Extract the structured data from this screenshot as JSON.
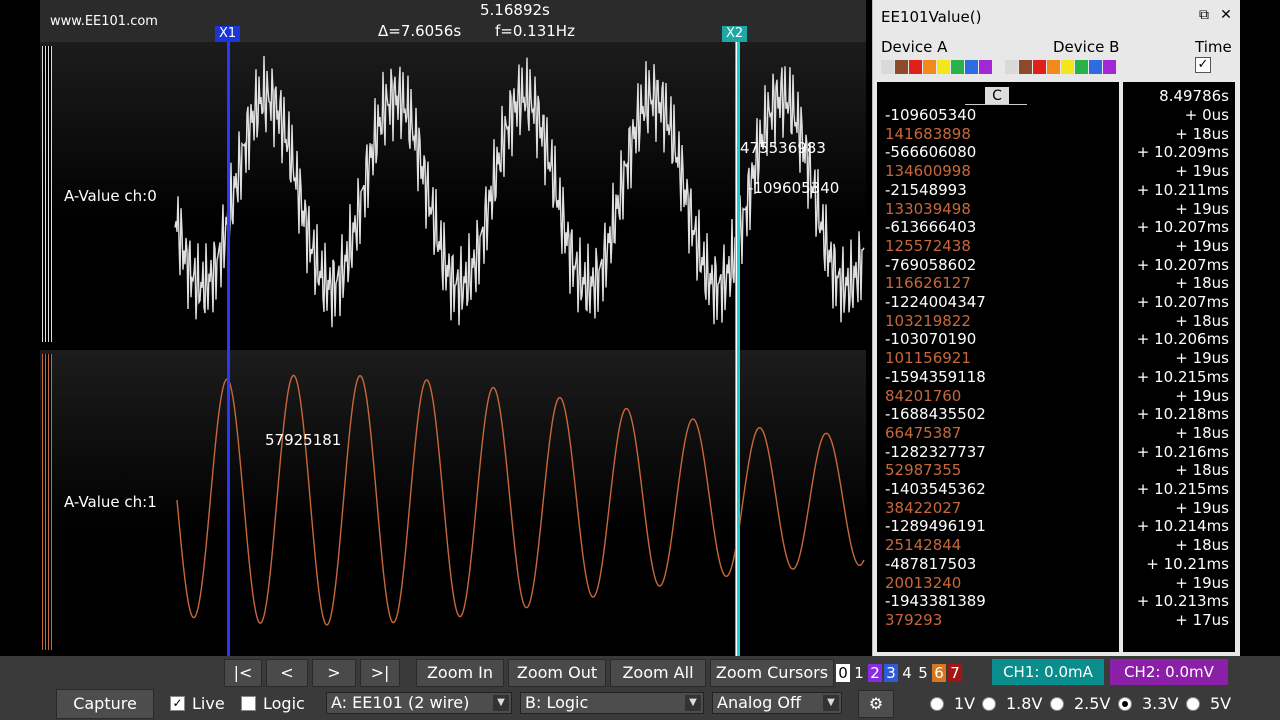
{
  "header": {
    "site": "www.EE101.com",
    "cursor_time": "5.16892s",
    "delta": "Δ=7.6056s",
    "freq": "f=0.131Hz",
    "x1": "X1",
    "x2": "X2"
  },
  "lanes": [
    {
      "label": "A-Value ch:0",
      "color": "#e0e0e0"
    },
    {
      "label": "A-Value ch:1",
      "color": "#c8683a"
    }
  ],
  "cursor_values": {
    "x2_ch0_a": "475536983",
    "x2_ch0_b": "-109605340",
    "x1_ch1": "57925181"
  },
  "panel": {
    "title": "EE101Value()",
    "restore_icon": "restore-icon",
    "close_icon": "close-icon",
    "device_a": "Device A",
    "device_b": "Device B",
    "time_label": "Time",
    "time_checked": true,
    "swatches_a": [
      "#d9d9d9",
      "#8b4a2b",
      "#e0201a",
      "#f18a1a",
      "#f3e61b",
      "#27b34a",
      "#2e6cdf",
      "#a228d6"
    ],
    "swatches_b": [
      "#d9d9d9",
      "#8b4a2b",
      "#e0201a",
      "#f18a1a",
      "#f3e61b",
      "#27b34a",
      "#2e6cdf",
      "#a228d6"
    ],
    "column_header": "C",
    "first_time": "8.49786s",
    "rows": [
      {
        "value": "-109605340",
        "time": "+ 0us",
        "kind": "a"
      },
      {
        "value": "141683898",
        "time": "+ 18us",
        "kind": "b"
      },
      {
        "value": "-566606080",
        "time": "+ 10.209ms",
        "kind": "a"
      },
      {
        "value": "134600998",
        "time": "+ 19us",
        "kind": "b"
      },
      {
        "value": "-21548993",
        "time": "+ 10.211ms",
        "kind": "a"
      },
      {
        "value": "133039498",
        "time": "+ 19us",
        "kind": "b"
      },
      {
        "value": "-613666403",
        "time": "+ 10.207ms",
        "kind": "a"
      },
      {
        "value": "125572438",
        "time": "+ 19us",
        "kind": "b"
      },
      {
        "value": "-769058602",
        "time": "+ 10.207ms",
        "kind": "a"
      },
      {
        "value": "116626127",
        "time": "+ 18us",
        "kind": "b"
      },
      {
        "value": "-1224004347",
        "time": "+ 10.207ms",
        "kind": "a"
      },
      {
        "value": "103219822",
        "time": "+ 18us",
        "kind": "b"
      },
      {
        "value": "-103070190",
        "time": "+ 10.206ms",
        "kind": "a"
      },
      {
        "value": "101156921",
        "time": "+ 19us",
        "kind": "b"
      },
      {
        "value": "-1594359118",
        "time": "+ 10.215ms",
        "kind": "a"
      },
      {
        "value": "84201760",
        "time": "+ 19us",
        "kind": "b"
      },
      {
        "value": "-1688435502",
        "time": "+ 10.218ms",
        "kind": "a"
      },
      {
        "value": "66475387",
        "time": "+ 18us",
        "kind": "b"
      },
      {
        "value": "-1282327737",
        "time": "+ 10.216ms",
        "kind": "a"
      },
      {
        "value": "52987355",
        "time": "+ 18us",
        "kind": "b"
      },
      {
        "value": "-1403545362",
        "time": "+ 10.215ms",
        "kind": "a"
      },
      {
        "value": "38422027",
        "time": "+ 19us",
        "kind": "b"
      },
      {
        "value": "-1289496191",
        "time": "+ 10.214ms",
        "kind": "a"
      },
      {
        "value": "25142844",
        "time": "+ 18us",
        "kind": "b"
      },
      {
        "value": "-487817503",
        "time": "+ 10.21ms",
        "kind": "a"
      },
      {
        "value": "20013240",
        "time": "+ 19us",
        "kind": "b"
      },
      {
        "value": "-1943381389",
        "time": "+ 10.213ms",
        "kind": "a"
      },
      {
        "value": "379293",
        "time": "+ 17us",
        "kind": "b"
      }
    ]
  },
  "toolbar": {
    "first": "|<",
    "prev": "<",
    "next": ">",
    "last": ">|",
    "zoom_in": "Zoom In",
    "zoom_out": "Zoom Out",
    "zoom_all": "Zoom All",
    "zoom_cursors": "Zoom Cursors",
    "channels": [
      {
        "num": "0",
        "bg": "#ffffff",
        "fg": "#000000"
      },
      {
        "num": "1",
        "bg": "#3a3a3a",
        "fg": "#ffffff"
      },
      {
        "num": "2",
        "bg": "#8a2be2",
        "fg": "#ffffff"
      },
      {
        "num": "3",
        "bg": "#2f5bd6",
        "fg": "#ffffff"
      },
      {
        "num": "4",
        "bg": "#3a3a3a",
        "fg": "#ffffff"
      },
      {
        "num": "5",
        "bg": "#3a3a3a",
        "fg": "#ffffff"
      },
      {
        "num": "6",
        "bg": "#d4771f",
        "fg": "#ffffff"
      },
      {
        "num": "7",
        "bg": "#a01515",
        "fg": "#ffffff"
      }
    ],
    "ch1_readout": "CH1: 0.0mA",
    "ch2_readout": "CH2: 0.0mV",
    "capture": "Capture",
    "live_label": "Live",
    "live_checked": true,
    "logic_label": "Logic",
    "logic_checked": false,
    "select_a": "A: EE101 (2 wire)",
    "select_b": "B: Logic",
    "select_analog": "Analog Off",
    "gear_icon": "gear-icon",
    "voltages": [
      "1V",
      "1.8V",
      "2.5V",
      "3.3V",
      "5V"
    ],
    "voltage_selected": "3.3V"
  }
}
